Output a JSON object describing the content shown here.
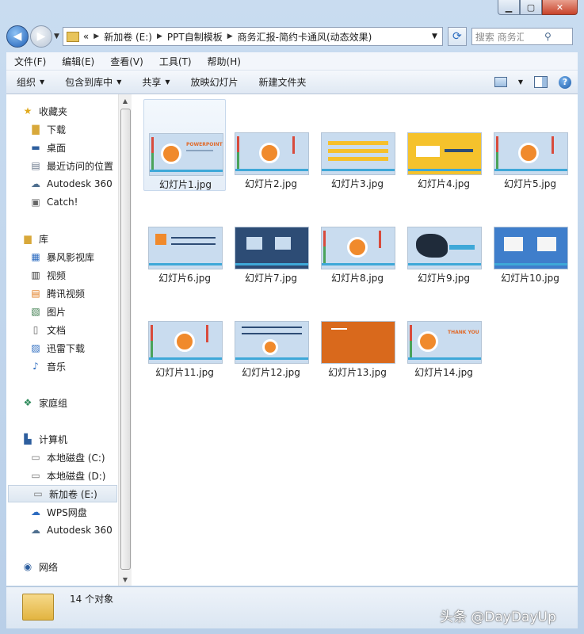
{
  "window": {
    "caption_buttons": {
      "minimize": "▁",
      "maximize": "▢",
      "close": "✕"
    }
  },
  "address_bar": {
    "prefix": "«",
    "crumbs": [
      "新加卷 (E:)",
      "PPT自制模板",
      "商务汇报-简约卡通风(动态效果)"
    ],
    "search_placeholder": "搜索 商务汇报-简..."
  },
  "menu": [
    "文件(F)",
    "编辑(E)",
    "查看(V)",
    "工具(T)",
    "帮助(H)"
  ],
  "toolbar": {
    "organize": "组织",
    "include_library": "包含到库中",
    "share": "共享",
    "slideshow": "放映幻灯片",
    "new_folder": "新建文件夹"
  },
  "nav": {
    "favorites": "收藏夹",
    "fav_items": [
      "下载",
      "桌面",
      "最近访问的位置",
      "Autodesk 360",
      "Catch!"
    ],
    "libraries": "库",
    "lib_items": [
      "暴风影视库",
      "视频",
      "腾讯视频",
      "图片",
      "文档",
      "迅雷下载",
      "音乐"
    ],
    "homegroup": "家庭组",
    "computer": "计算机",
    "comp_items": [
      "本地磁盘 (C:)",
      "本地磁盘 (D:)",
      "新加卷 (E:)",
      "WPS网盘",
      "Autodesk 360"
    ],
    "network": "网络"
  },
  "files": [
    "幻灯片1.jpg",
    "幻灯片2.jpg",
    "幻灯片3.jpg",
    "幻灯片4.jpg",
    "幻灯片5.jpg",
    "幻灯片6.jpg",
    "幻灯片7.jpg",
    "幻灯片8.jpg",
    "幻灯片9.jpg",
    "幻灯片10.jpg",
    "幻灯片11.jpg",
    "幻灯片12.jpg",
    "幻灯片13.jpg",
    "幻灯片14.jpg"
  ],
  "thumb_text": {
    "slide1": "POWERPOINT",
    "slide14": "THANK YOU"
  },
  "status": {
    "count": "14 个对象"
  },
  "watermark": "头条 @DayDayUp",
  "colors": {
    "accent_orange": "#f08a2c",
    "accent_blue": "#3ea8d8",
    "slide_bg": "#c9dcef",
    "slide13_bg": "#d9691c"
  }
}
